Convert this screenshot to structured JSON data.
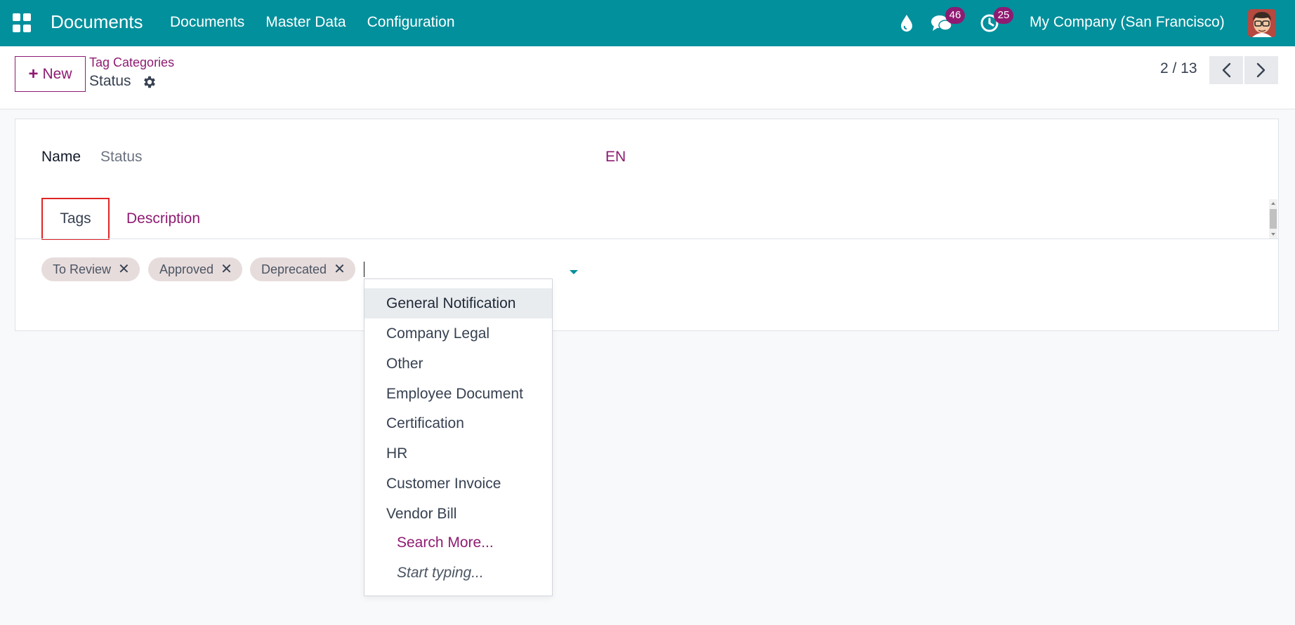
{
  "navbar": {
    "brand": "Documents",
    "menu": [
      "Documents",
      "Master Data",
      "Configuration"
    ],
    "messages_count": "46",
    "activities_count": "25",
    "company": "My Company (San Francisco)",
    "icons": [
      "apps-icon",
      "drop-icon",
      "chat-icon",
      "clock-icon",
      "avatar"
    ]
  },
  "control_panel": {
    "new_label": "New",
    "breadcrumb_parent": "Tag Categories",
    "breadcrumb_current": "Status",
    "pager": "2 / 13"
  },
  "form": {
    "name_label": "Name",
    "name_value": "Status",
    "lang": "EN",
    "tabs": [
      {
        "label": "Tags",
        "active": true
      },
      {
        "label": "Description",
        "active": false
      }
    ],
    "tags": [
      "To Review",
      "Approved",
      "Deprecated"
    ]
  },
  "dropdown": {
    "items": [
      "General Notification",
      "Company Legal",
      "Other",
      "Employee Document",
      "Certification",
      "HR",
      "Customer Invoice",
      "Vendor Bill"
    ],
    "search_more": "Search More...",
    "hint": "Start typing..."
  },
  "colors": {
    "navbar": "#01909c",
    "accent": "#8e1b72",
    "highlight_border": "#e02424"
  }
}
